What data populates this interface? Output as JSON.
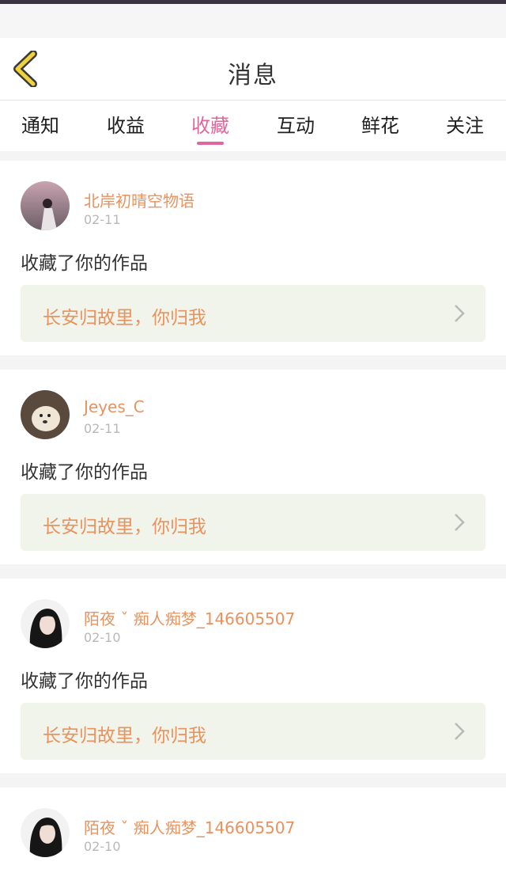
{
  "header": {
    "title": "消息"
  },
  "tabs": [
    {
      "label": "通知"
    },
    {
      "label": "收益"
    },
    {
      "label": "收藏",
      "active": true
    },
    {
      "label": "互动"
    },
    {
      "label": "鲜花"
    },
    {
      "label": "关注"
    }
  ],
  "notifications": [
    {
      "username": "北岸初晴空物语",
      "date": "02-11",
      "action": "收藏了你的作品",
      "work_title": "长安归故里，你归我",
      "avatar": "avatar-icon"
    },
    {
      "username": "Jeyes_C",
      "date": "02-11",
      "action": "收藏了你的作品",
      "work_title": "长安归故里，你归我",
      "avatar": "avatar-icon"
    },
    {
      "username": "陌夜 ˇ 痴人痴梦_146605507",
      "date": "02-10",
      "action": "收藏了你的作品",
      "work_title": "长安归故里，你归我",
      "avatar": "avatar-icon"
    },
    {
      "username": "陌夜 ˇ 痴人痴梦_146605507",
      "date": "02-10",
      "action": "",
      "work_title": "",
      "avatar": "avatar-icon"
    }
  ],
  "colors": {
    "accent_pink": "#e0669e",
    "username_orange": "#e8935f",
    "back_arrow_yellow": "#f0d23c",
    "work_box_bg": "#f1f4ea"
  },
  "icons": {
    "back": "back-chevron-icon",
    "chevron": "chevron-right-icon"
  }
}
